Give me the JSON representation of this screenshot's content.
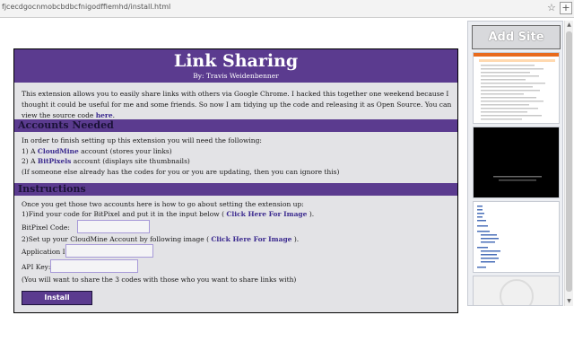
{
  "browser": {
    "url": "fjcecdgocnmobcbdbcfnigodffiemhd/install.html",
    "star_glyph": "☆",
    "plus_glyph": "+"
  },
  "header": {
    "title": "Link Sharing",
    "byline": "By: Travis Weidenbenner"
  },
  "intro": {
    "text": "This extension allows you to easily share links with others via Google Chrome. I hacked this together one weekend because I thought it could be useful for me and some friends. So now I am tidying up the code and releasing it as Open Source. You can view the source code ",
    "link": "here",
    "end": "."
  },
  "accounts": {
    "heading": "Accounts Needed",
    "lead": "In order to finish setting up this extension you will need the following:",
    "item1_prefix": "1) A ",
    "item1_link": "CloudMine",
    "item1_suffix": " account (stores your links)",
    "item2_prefix": "2) A ",
    "item2_link": "BitPixels",
    "item2_suffix": " account (displays site thumbnails)",
    "note": "(If someone else already has the codes for you or you are updating, then you can ignore this)"
  },
  "instructions": {
    "heading": "Instructions",
    "lead": "Once you get those two accounts here is how to go about setting the extension up:",
    "step1_prefix": "1)Find your code for BitPixel and put it in the input below ( ",
    "step1_link": "Click Here For Image",
    "step1_suffix": " ).",
    "bitpixel_label": "BitPixel Code:",
    "step2_prefix": "2)Set up your CloudMine Account by following image ( ",
    "step2_link": "Click Here For Image",
    "step2_suffix": " ).",
    "appid_label": "Application ID:",
    "apikey_label": "API Key:",
    "note": "(You will want to share the 3 codes with those who you want to share links with)",
    "install_label": "Install"
  },
  "sidebar": {
    "add_site_label": "Add Site"
  },
  "colors": {
    "accent": "#5b3b8f",
    "panel_bg": "#e3e3e6",
    "link": "#3b2a8f"
  }
}
